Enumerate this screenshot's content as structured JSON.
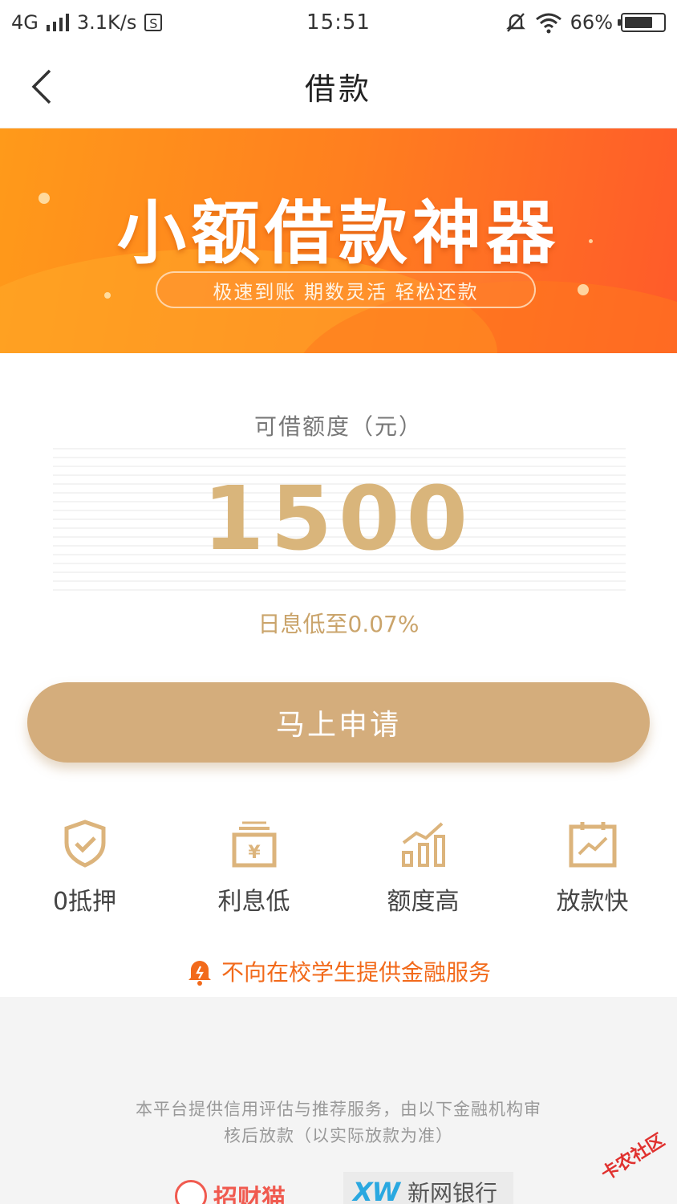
{
  "status_bar": {
    "network": "4G",
    "speed": "3.1K/s",
    "s_badge": "S",
    "time": "15:51",
    "battery": "66%"
  },
  "header": {
    "title": "借款"
  },
  "banner": {
    "title": "小额借款神器",
    "subtitle": "极速到账 期数灵活 轻松还款"
  },
  "credit": {
    "label": "可借额度（元）",
    "amount": "1500",
    "rate": "日息低至0.07%"
  },
  "apply_button": {
    "label": "马上申请"
  },
  "features": [
    {
      "label": "0抵押",
      "icon": "shield-check-icon"
    },
    {
      "label": "利息低",
      "icon": "yuan-wallet-icon"
    },
    {
      "label": "额度高",
      "icon": "bar-chart-icon"
    },
    {
      "label": "放款快",
      "icon": "calendar-trend-icon"
    }
  ],
  "notice": {
    "text": "不向在校学生提供金融服务"
  },
  "footer": {
    "disclaimer_line1": "本平台提供信用评估与推荐服务，由以下金融机构审",
    "disclaimer_line2": "核后放款（以实际放款为准）",
    "partners": [
      {
        "name": "招财猫"
      },
      {
        "logo": "XW",
        "name": "新网银行"
      }
    ],
    "watermark": "卡农社区"
  },
  "colors": {
    "gold": "#d4ad7c",
    "amount_gold": "#d9b57b",
    "orange": "#f26a1b",
    "banner_start": "#ff9a1a",
    "banner_end": "#ff5a2a"
  }
}
